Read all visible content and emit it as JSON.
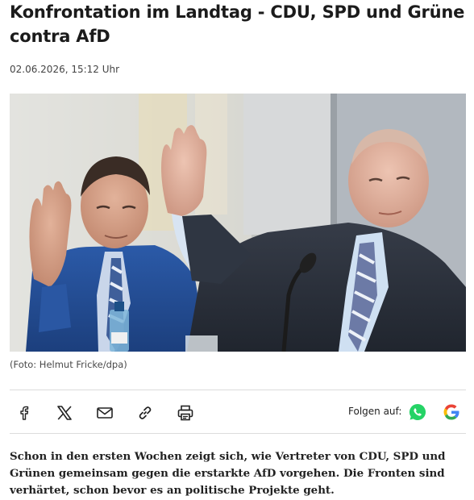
{
  "article": {
    "headline_line1": "Konfrontation im Landtag - CDU, SPD und Grüne",
    "headline_line2": "contra AfD",
    "date": "02.06.2026, 15:12 Uhr",
    "photo_caption": "(Foto: Helmut Fricke/dpa)",
    "lead_line1": "Schon in den ersten Wochen zeigt sich, wie Vertreter von CDU, SPD und",
    "lead_line2": "Grünen gemeinsam gegen die erstarkte AfD vorgehen. Die Fronten sind",
    "lead_line3": "verhärtet, schon bevor es an politische Projekte geht."
  },
  "share": {
    "icons": [
      "facebook-icon",
      "x-icon",
      "mail-icon",
      "link-icon",
      "print-icon"
    ],
    "follow_label": "Folgen auf:",
    "follow_icons": [
      "whatsapp-icon",
      "google-icon"
    ]
  },
  "colors": {
    "whatsapp": "#25d366",
    "google_blue": "#4285f4",
    "google_red": "#ea4335",
    "google_yellow": "#fbbc05",
    "google_green": "#34a853"
  }
}
